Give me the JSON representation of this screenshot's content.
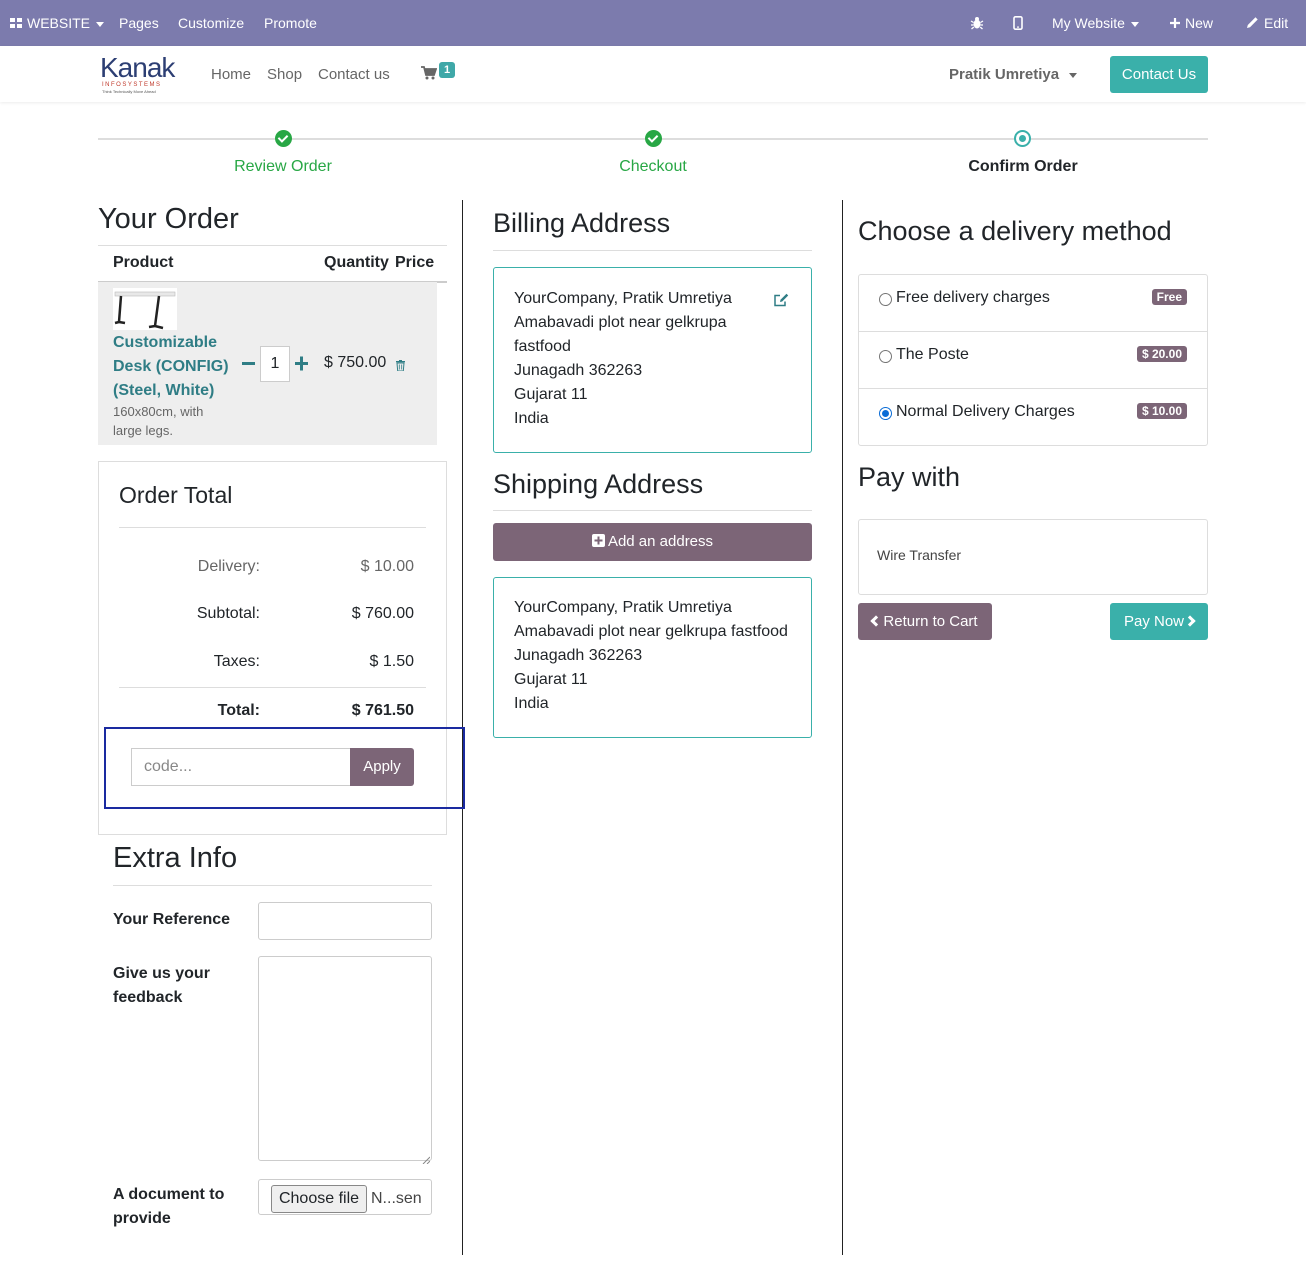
{
  "admin_bar": {
    "website_label": "WEBSITE",
    "pages": "Pages",
    "customize": "Customize",
    "promote": "Promote",
    "my_website": "My Website",
    "new": "New",
    "edit": "Edit"
  },
  "nav": {
    "logo_main": "Kanak",
    "logo_sub": "INFOSYSTEMS",
    "logo_tagline": "Think Technically Move Ahead",
    "home": "Home",
    "shop": "Shop",
    "contact": "Contact us",
    "cart_count": "1",
    "user": "Pratik Umretiya",
    "contact_button": "Contact Us"
  },
  "progress": {
    "steps": [
      {
        "label": "Review Order",
        "state": "done"
      },
      {
        "label": "Checkout",
        "state": "done"
      },
      {
        "label": "Confirm Order",
        "state": "current"
      }
    ]
  },
  "order": {
    "title": "Your Order",
    "headers": {
      "product": "Product",
      "quantity": "Quantity",
      "price": "Price"
    },
    "items": [
      {
        "name": "Customizable Desk (CONFIG) (Steel, White)",
        "description": "160x80cm, with large legs.",
        "quantity": "1",
        "price": "$ 750.00"
      }
    ]
  },
  "totals": {
    "title": "Order Total",
    "delivery_label": "Delivery:",
    "delivery_value": "$ 10.00",
    "subtotal_label": "Subtotal:",
    "subtotal_value": "$ 760.00",
    "taxes_label": "Taxes:",
    "taxes_value": "$ 1.50",
    "total_label": "Total:",
    "total_value": "$ 761.50",
    "promo_placeholder": "code...",
    "apply_label": "Apply"
  },
  "extra": {
    "title": "Extra Info",
    "reference_label": "Your Reference",
    "reference_value": "",
    "feedback_label": "Give us your feedback",
    "feedback_value": "",
    "document_label": "A document to provide",
    "file_button": "Choose file",
    "file_name": "N...sen"
  },
  "billing": {
    "title": "Billing Address",
    "lines": [
      "YourCompany, Pratik Umretiya",
      "Amabavadi plot near gelkrupa",
      "fastfood",
      "Junagadh 362263",
      "Gujarat 11",
      "India"
    ]
  },
  "shipping": {
    "title": "Shipping Address",
    "add_button": "Add an address",
    "lines": [
      "YourCompany, Pratik Umretiya",
      "Amabavadi plot near gelkrupa fastfood",
      "Junagadh 362263",
      "Gujarat 11",
      "India"
    ]
  },
  "delivery": {
    "title": "Choose a delivery method",
    "options": [
      {
        "label": "Free delivery charges",
        "price": "Free",
        "selected": false
      },
      {
        "label": "The Poste",
        "price": "$ 20.00",
        "selected": false
      },
      {
        "label": "Normal Delivery Charges",
        "price": "$ 10.00",
        "selected": true
      }
    ]
  },
  "payment": {
    "title": "Pay with",
    "method": "Wire Transfer",
    "return_button": "Return to Cart",
    "pay_button": "Pay Now"
  },
  "colors": {
    "admin_bar": "#7c7bad",
    "teal": "#3ab0aa",
    "mauve": "#7c6577",
    "success": "#28a745",
    "link": "#2f7d85"
  }
}
